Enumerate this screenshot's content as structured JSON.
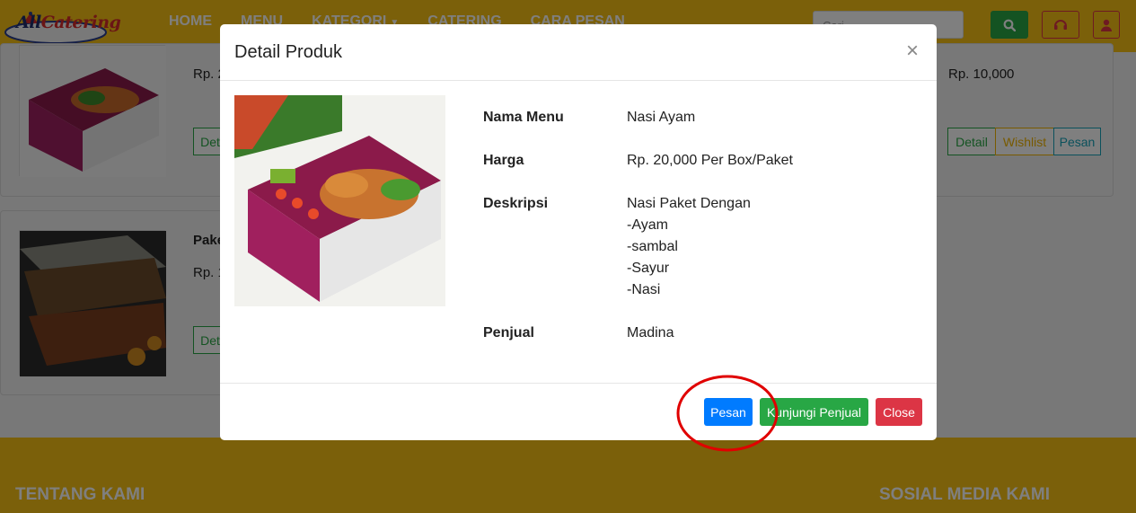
{
  "navbar": {
    "logo_text_a": "All",
    "logo_text_b": "Catering",
    "links": [
      "HOME",
      "MENU",
      "KATEGORI",
      "CATERING",
      "CARA PESAN"
    ],
    "search_placeholder": "Cari...",
    "colors": {
      "bar": "#f7c014",
      "search": "#28a745",
      "icon_btn": "#dc3545"
    }
  },
  "background": {
    "card1": {
      "price_left": "Rp. 2",
      "price_right": "Rp. 10,000",
      "btn_detail_cut": "Det",
      "btn_detail": "Detail",
      "btn_wishlist": "Wishlist",
      "btn_pesan": "Pesan"
    },
    "card2": {
      "name_cut": "Pake",
      "price_cut": "Rp. 1",
      "btn_detail_cut": "Det"
    }
  },
  "modal": {
    "title": "Detail Produk",
    "close_symbol": "×",
    "details": [
      {
        "label": "Nama Menu",
        "value": [
          "Nasi Ayam"
        ]
      },
      {
        "label": "Harga",
        "value": [
          "Rp. 20,000 Per Box/Paket"
        ]
      },
      {
        "label": "Deskripsi",
        "value": [
          "Nasi Paket Dengan",
          "-Ayam",
          "-sambal",
          "-Sayur",
          "-Nasi"
        ]
      },
      {
        "label": "Penjual",
        "value": [
          "Madina"
        ]
      }
    ],
    "buttons": {
      "pesan": "Pesan",
      "kunjungi": "Kunjungi Penjual",
      "close": "Close"
    }
  },
  "footer": {
    "about": "TENTANG KAMI",
    "social": "SOSIAL MEDIA KAMI"
  }
}
